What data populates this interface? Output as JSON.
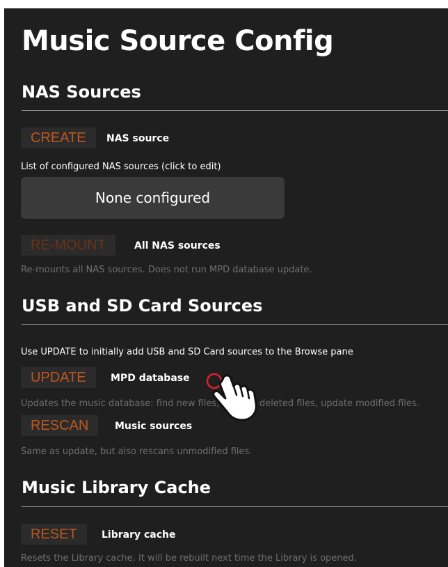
{
  "page": {
    "title": "Music Source Config"
  },
  "nas": {
    "heading": "NAS Sources",
    "create_button": "CREATE",
    "create_caption": "NAS source",
    "list_label": "List of configured NAS sources (click to edit)",
    "none_label": "None configured",
    "remount_button": "RE-MOUNT",
    "remount_caption": "All NAS sources",
    "remount_help": "Re-mounts all NAS sources. Does not run MPD database update."
  },
  "usb": {
    "heading": "USB and SD Card Sources",
    "intro": "Use UPDATE to initially add USB and SD Card sources to the Browse pane",
    "update_button": "UPDATE",
    "update_caption": "MPD database",
    "update_help": "Updates the music database: find new files, remove deleted files, update modified files.",
    "rescan_button": "RESCAN",
    "rescan_caption": "Music sources",
    "rescan_help": "Same as update, but also rescans unmodified files."
  },
  "cache": {
    "heading": "Music Library Cache",
    "reset_button": "RESET",
    "reset_caption": "Library cache",
    "reset_help": "Resets the Library cache. It will be rebuilt next time the Library is opened."
  },
  "colors": {
    "background": "#1f1f1f",
    "button_text": "#c0561c",
    "muted_text": "#6f6f6f"
  },
  "icons": {
    "pointer": "hand-pointer-icon"
  }
}
